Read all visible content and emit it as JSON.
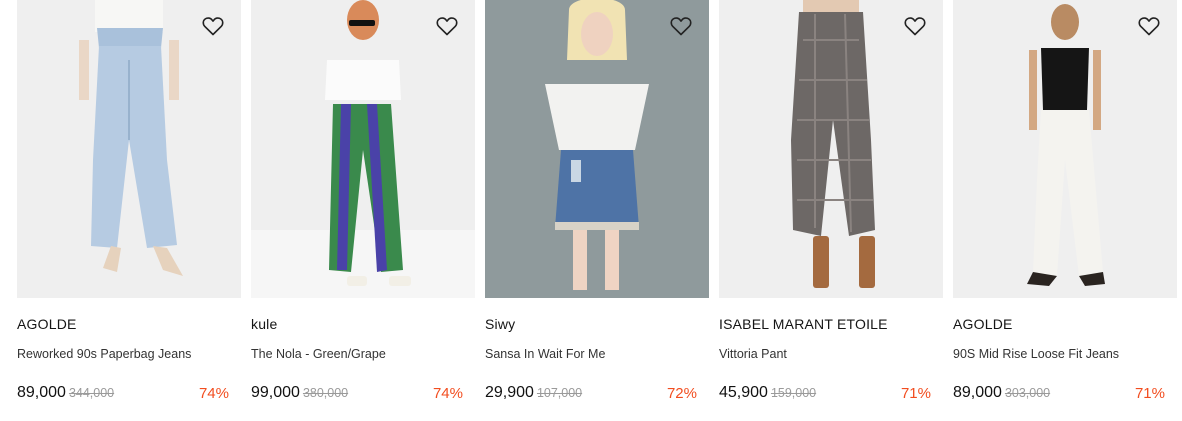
{
  "products": [
    {
      "brand": "AGOLDE",
      "name": "Reworked 90s Paperbag Jeans",
      "price": "89,000",
      "original_price": "344,000",
      "discount": "74%",
      "wishlist_icon": "heart-outline-icon"
    },
    {
      "brand": "kule",
      "name": "The Nola - Green/Grape",
      "price": "99,000",
      "original_price": "380,000",
      "discount": "74%",
      "wishlist_icon": "heart-outline-icon"
    },
    {
      "brand": "Siwy",
      "name": "Sansa In Wait For Me",
      "price": "29,900",
      "original_price": "107,000",
      "discount": "72%",
      "wishlist_icon": "heart-outline-icon"
    },
    {
      "brand": "ISABEL MARANT ETOILE",
      "name": "Vittoria Pant",
      "price": "45,900",
      "original_price": "159,000",
      "discount": "71%",
      "wishlist_icon": "heart-outline-icon"
    },
    {
      "brand": "AGOLDE",
      "name": "90S Mid Rise Loose Fit Jeans",
      "price": "89,000",
      "original_price": "303,000",
      "discount": "71%",
      "wishlist_icon": "heart-outline-icon"
    }
  ],
  "colors": {
    "discount": "#f24d1f",
    "image_background": "#efefef",
    "image_background_alt": "#8f9a9c"
  }
}
